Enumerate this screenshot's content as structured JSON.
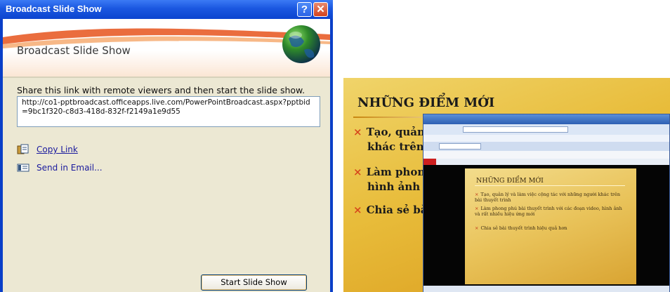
{
  "dialog": {
    "window_title": "Broadcast Slide Show",
    "help_label": "?",
    "close_label": "✕",
    "banner_title": "Broadcast Slide Show",
    "instruction": "Share this link with remote viewers and then start the slide show.",
    "link": "http://co1-pptbroadcast.officeapps.live.com/PowerPointBroadcast.aspx?pptbid=9bc1f320-c8d3-418d-832f-f2149a1e9d55",
    "copy_link_label": "Copy Link",
    "send_email_label": "Send in Email...",
    "start_button_label": "Start Slide Show",
    "icons": [
      "globe-icon",
      "copy-link-icon",
      "email-icon",
      "help-icon",
      "close-icon"
    ]
  },
  "slide": {
    "title": "NHỮNG ĐIỂM MỚI",
    "bullets": [
      "Tạo, quản",
      "khác trên",
      "Làm phon",
      "hình ảnh v",
      "Chia sẻ bà"
    ],
    "bullet_marker": "×"
  },
  "inner_slide": {
    "title": "NHỮNG ĐIỂM MỚI",
    "bullets": [
      "Tạo, quản lý và làm việc cộng tác với những người khác trên bài thuyết trình",
      "Làm phong phú bài thuyết trình với các đoạn video, hình ảnh và rất nhiều hiệu ứng mới",
      "Chia sẻ bài thuyết trình hiệu quả hơn"
    ]
  },
  "colors": {
    "titlebar": "#1a57e0",
    "dialog_body": "#ece8d3",
    "link_text": "#1a1a9e",
    "slide_gold": "#e8bc3a",
    "bullet_marker": "#d6451b"
  }
}
